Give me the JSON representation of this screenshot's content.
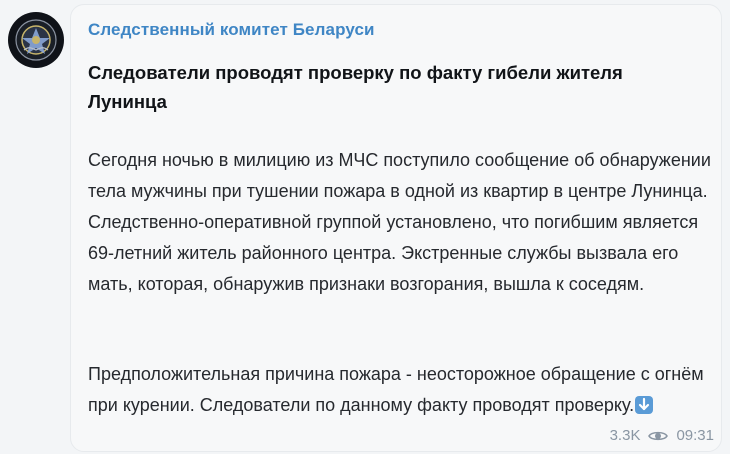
{
  "post": {
    "channel_name": "Следственный комитет Беларуси",
    "headline": "Следователи проводят проверку по факту гибели жителя Лунинца",
    "paragraph1": "Сегодня ночью в милицию из МЧС поступило сообщение об обнаружении тела мужчины при тушении пожара в одной из квартир в центре Лунинца. Следственно-оперативной группой установлено, что погибшим является 69-летний житель районного центра. Экстренные службы вызвала его мать, которая, обнаружив признаки возгорания, вышла к соседям.",
    "paragraph2": "Предположительная причина пожара - неосторожное обращение с огнём при курении. Следователи по данному факту проводят проверку.",
    "views": "3.3K",
    "time": "09:31"
  },
  "icons": {
    "avatar": "emblem-icon",
    "emoji": "down-arrow-emoji-icon",
    "views": "eye-icon"
  },
  "colors": {
    "channel_name": "#3f86c5",
    "meta": "#8a96a3",
    "avatar_bg": "#0f1218",
    "emoji_bg": "#5a9bd6"
  }
}
